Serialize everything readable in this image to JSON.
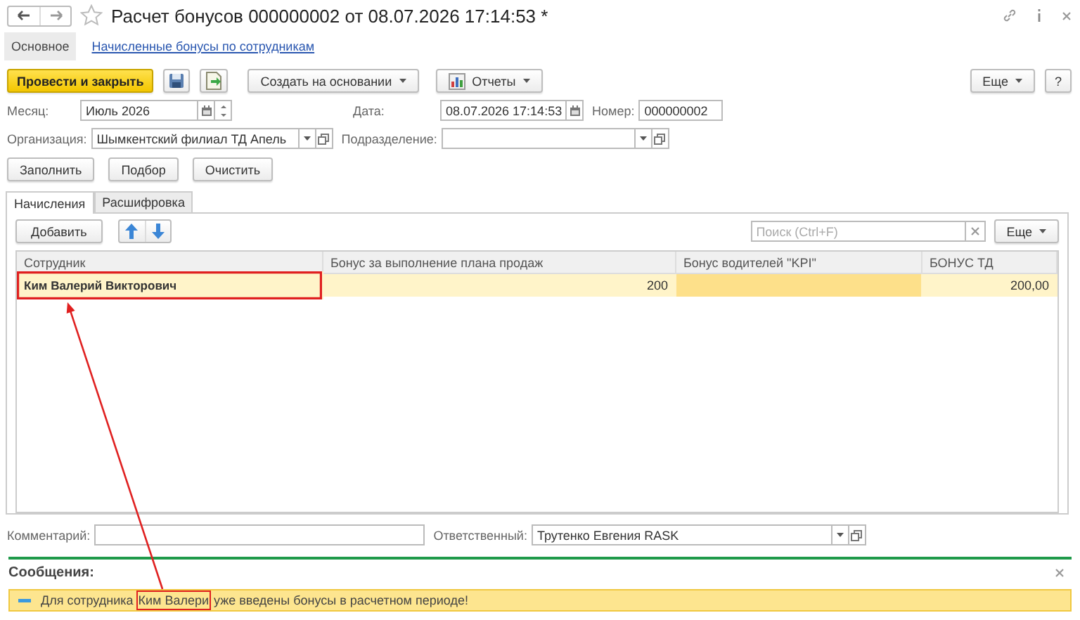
{
  "window": {
    "title": "Расчет бонусов 000000002 от 08.07.2026 17:14:53 *"
  },
  "nav_tabs": [
    {
      "label": "Основное",
      "selected": true
    },
    {
      "label": "Начисленные бонусы по сотрудникам",
      "selected": false
    }
  ],
  "command_bar": {
    "items": [
      {
        "kind": "primary",
        "label": "Провести и закрыть"
      },
      {
        "kind": "icon"
      },
      {
        "kind": "icon"
      },
      {
        "kind": "menu",
        "label": "Создать на основании"
      },
      {
        "kind": "menu",
        "label": "Отчеты"
      }
    ],
    "more": "Еще",
    "help": "?"
  },
  "fields": {
    "month": {
      "label": "Месяц:",
      "value": "Июль 2026"
    },
    "date": {
      "label": "Дата:",
      "value": "08.07.2026 17:14:53"
    },
    "number": {
      "label": "Номер:",
      "value": "000000002"
    },
    "organization": {
      "label": "Организация:",
      "value": "Шымкентский филиал ТД Апель"
    },
    "department": {
      "label": "Подразделение:"
    }
  },
  "fill_buttons": [
    "Заполнить",
    "Подбор",
    "Очистить"
  ],
  "tabs": [
    {
      "label": "Начисления",
      "selected": true
    },
    {
      "label": "Расшифровка",
      "selected": false
    }
  ],
  "table_toolbar": {
    "add": "Добавить",
    "search": {
      "placeholder": "Поиск (Ctrl+F)"
    },
    "more": "Еще"
  },
  "table": {
    "columns": [
      "Сотрудник",
      "Бонус за выполнение плана продаж",
      "Бонус водителей \"KPI\"",
      "БОНУС ТД"
    ],
    "rows": [
      {
        "selected": true,
        "cells": [
          {
            "text": "Ким Валерий Викторович",
            "current": false,
            "annotated": true
          },
          {
            "text": "200",
            "current": false,
            "annotated": false
          },
          {
            "current": true,
            "annotated": false
          },
          {
            "text": "200,00",
            "current": false,
            "annotated": false
          }
        ]
      }
    ]
  },
  "footer": {
    "comment": {
      "label": "Комментарий:"
    },
    "responsible": {
      "label": "Ответственный:",
      "value": "Трутенко Евгения RASK"
    }
  },
  "messages": {
    "title": "Сообщения:",
    "items": [
      {
        "parts": [
          {
            "text": "Для сотрудника ",
            "annotated": false
          },
          {
            "text": "Ким Валери",
            "annotated": true
          },
          {
            "text": " уже введены бонусы в расчетном периоде!",
            "annotated": false
          }
        ]
      }
    ]
  },
  "annotation": {
    "color": "#e02020"
  }
}
